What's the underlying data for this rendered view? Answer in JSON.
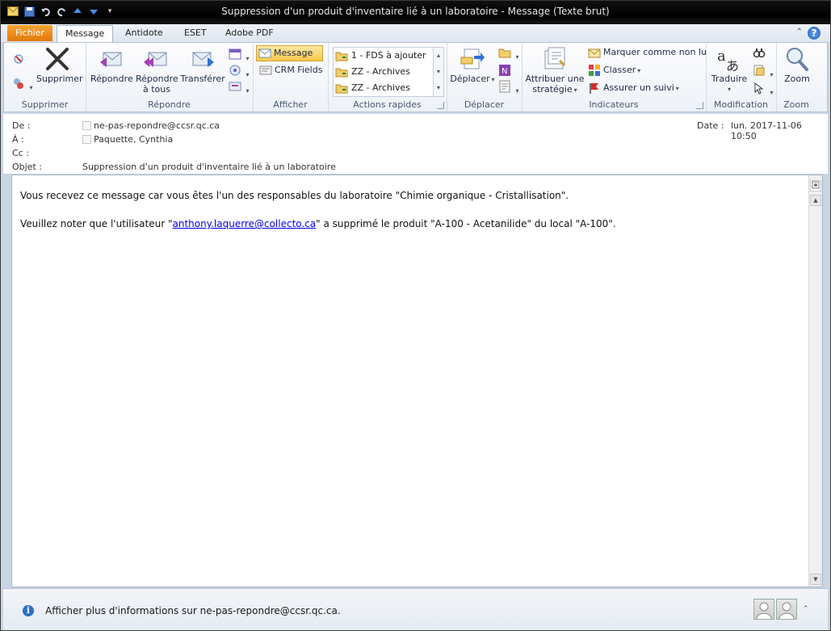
{
  "window": {
    "title": "Suppression d'un produit d'inventaire lié à un laboratoire  -  Message (Texte brut)"
  },
  "tabs": [
    {
      "label": "Fichier"
    },
    {
      "label": "Message"
    },
    {
      "label": "Antidote"
    },
    {
      "label": "ESET"
    },
    {
      "label": "Adobe PDF"
    }
  ],
  "ribbon": {
    "supprimer": {
      "label": "Supprimer",
      "delete_btn": "Supprimer"
    },
    "repondre": {
      "label": "Répondre",
      "reply": "Répondre",
      "reply_all_1": "Répondre",
      "reply_all_2": "à tous",
      "forward": "Transférer"
    },
    "afficher": {
      "label": "Afficher",
      "message": "Message",
      "crm": "CRM Fields"
    },
    "quicksteps": {
      "label": "Actions rapides",
      "items": [
        "1 - FDS à ajouter",
        "ZZ - Archives",
        "ZZ - Archives"
      ]
    },
    "deplacer": {
      "label": "Déplacer",
      "move": "Déplacer"
    },
    "indicateurs": {
      "label": "Indicateurs",
      "strategy_1": "Attribuer une",
      "strategy_2": "stratégie",
      "unread": "Marquer comme non lu",
      "categorize": "Classer",
      "followup": "Assurer un suivi"
    },
    "modification": {
      "label": "Modification",
      "translate": "Traduire"
    },
    "zoom": {
      "label": "Zoom",
      "zoom": "Zoom"
    }
  },
  "header": {
    "from_label": "De :",
    "from_value": "ne-pas-repondre@ccsr.qc.ca",
    "to_label": "À :",
    "to_value": "Paquette, Cynthia",
    "cc_label": "Cc :",
    "subject_label": "Objet :",
    "subject_value": "Suppression d'un produit d'inventaire lié à un laboratoire",
    "date_label": "Date :",
    "date_value": "lun. 2017-11-06 10:50"
  },
  "body": {
    "line1": "Vous recevez ce message car vous êtes l'un des responsables du laboratoire \"Chimie organique - Cristallisation\".",
    "line2_pre": "Veuillez noter que l'utilisateur \"",
    "line2_link": "anthony.laquerre@collecto.ca",
    "line2_post": "\" a supprimé le produit \"A-100 - Acetanilide\" du local \"A-100\"."
  },
  "footer": {
    "info": "Afficher plus d'informations sur ne-pas-repondre@ccsr.qc.ca."
  }
}
